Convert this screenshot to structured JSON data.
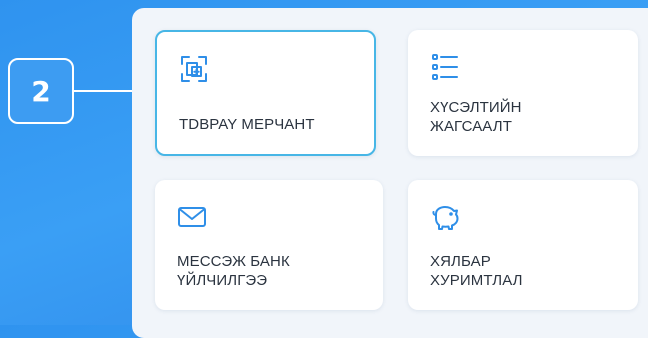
{
  "step": {
    "number": "2"
  },
  "menu": {
    "items": [
      {
        "icon": "merchant-scan-icon",
        "label_lines": [
          "TDBPAY МЕРЧАНТ"
        ],
        "selected": true
      },
      {
        "icon": "checklist-icon",
        "label_lines": [
          "ХҮСЭЛТИЙН",
          "ЖАГСААЛТ"
        ],
        "selected": false
      },
      {
        "icon": "envelope-icon",
        "label_lines": [
          "МЕССЭЖ БАНК",
          "ҮЙЛЧИЛГЭЭ"
        ],
        "selected": false
      },
      {
        "icon": "piggy-bank-icon",
        "label_lines": [
          "ХЯЛБАР",
          "ХУРИМТЛАЛ"
        ],
        "selected": false
      }
    ]
  },
  "colors": {
    "background": "#3399f0",
    "accent": "#2f8fe8",
    "selected_border": "#47b6e6",
    "label_text": "#2b3440"
  }
}
